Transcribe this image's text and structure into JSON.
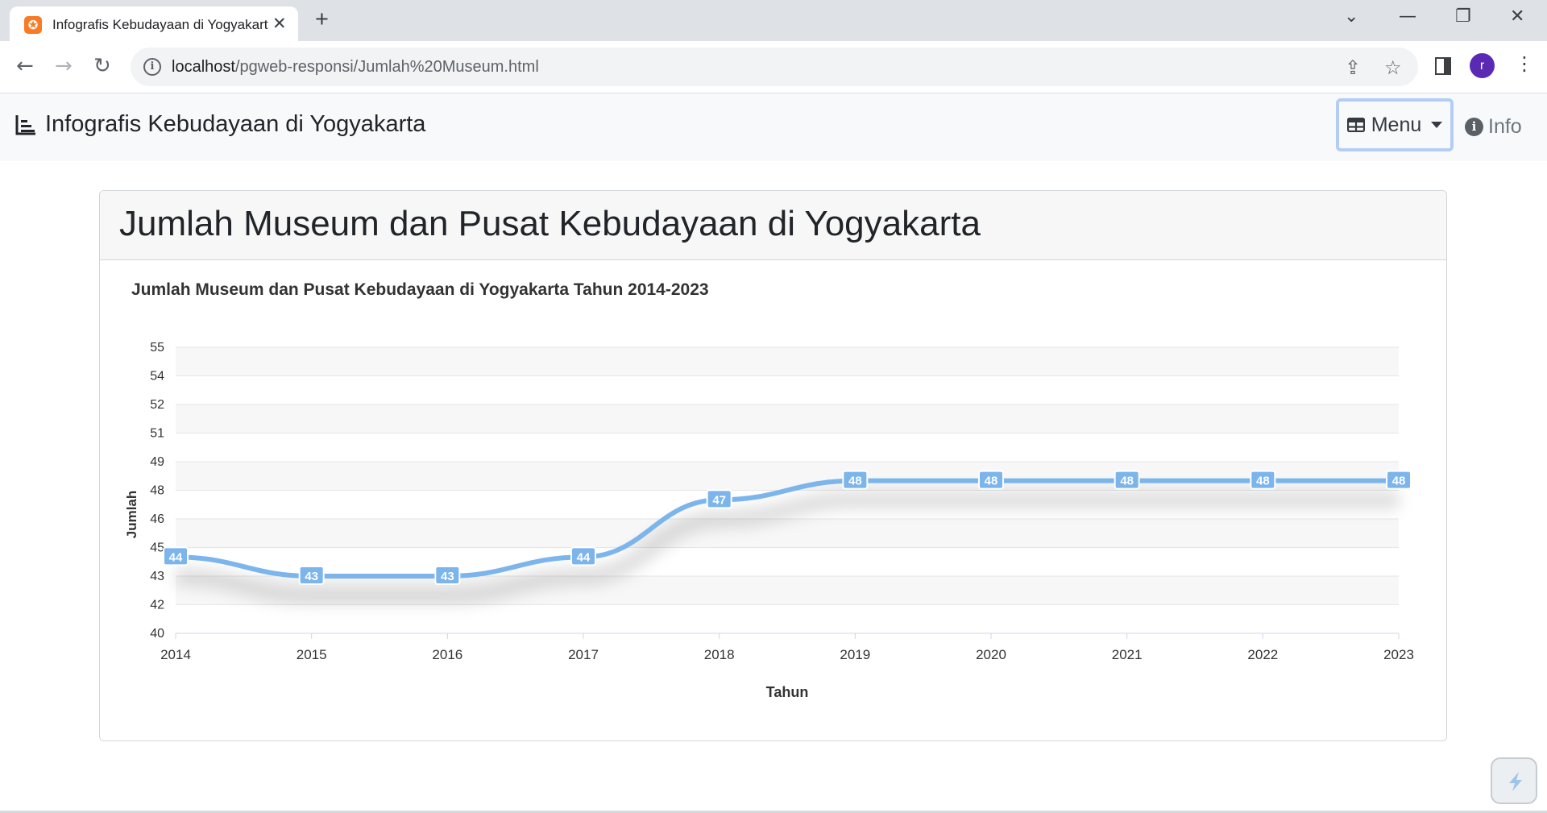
{
  "browser": {
    "tab_title": "Infografis Kebudayaan di Yogyakarta",
    "tab_icon": "xampp-icon",
    "url_host": "localhost",
    "url_path": "/pgweb-responsi/Jumlah%20Museum.html",
    "profile_initial": "r"
  },
  "navbar": {
    "brand": "Infografis Kebudayaan di Yogyakarta",
    "brand_icon": "chart-line-icon",
    "menu_label": "Menu",
    "menu_icon": "table-icon",
    "info_label": "Info",
    "info_icon": "info-circle-icon"
  },
  "card": {
    "title": "Jumlah Museum dan Pusat Kebudayaan di Yogyakarta"
  },
  "chart_data": {
    "type": "line",
    "title": "Jumlah Museum dan Pusat Kebudayaan di Yogyakarta Tahun 2014-2023",
    "xlabel": "Tahun",
    "ylabel": "Jumlah",
    "x": [
      "2014",
      "2015",
      "2016",
      "2017",
      "2018",
      "2019",
      "2020",
      "2021",
      "2022",
      "2023"
    ],
    "series": [
      {
        "values": [
          44,
          43,
          43,
          44,
          47,
          48,
          48,
          48,
          48,
          48
        ],
        "color": "#7cb5ec"
      }
    ],
    "data_labels": [
      "44",
      "43",
      "43",
      "44",
      "47",
      "48",
      "48",
      "48",
      "48",
      "48"
    ],
    "yticks": [
      "40",
      "42",
      "43",
      "45",
      "46",
      "48",
      "49",
      "51",
      "52",
      "54",
      "55"
    ],
    "ylim": [
      40,
      55
    ],
    "grid": true,
    "smooth": true
  },
  "colors": {
    "line": "#7cb5ec",
    "focus_ring": "#b4cdf5"
  }
}
